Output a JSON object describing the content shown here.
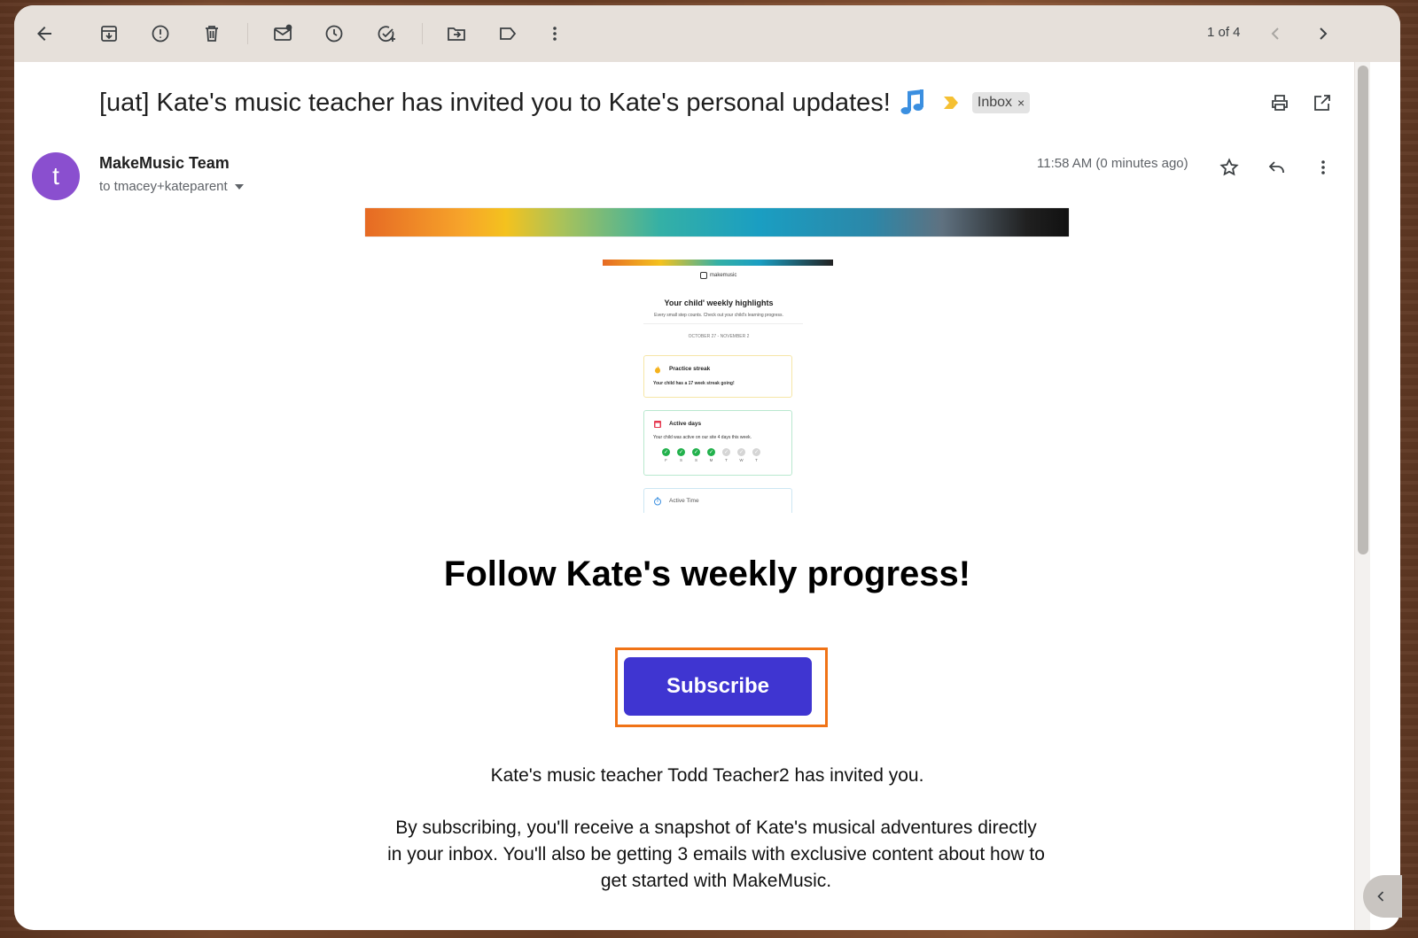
{
  "toolbar": {
    "pager_text": "1 of 4",
    "icons": [
      "back-arrow-icon",
      "archive-icon",
      "report-spam-icon",
      "delete-icon",
      "mark-unread-icon",
      "snooze-icon",
      "add-to-tasks-icon",
      "move-to-icon",
      "label-icon",
      "more-vert-icon",
      "older-chevron-icon",
      "newer-chevron-icon"
    ]
  },
  "email": {
    "subject": "[uat] Kate's music teacher has invited you to Kate's personal updates!",
    "label_chip": "Inbox",
    "label_chip_close": "×",
    "sender_initial": "t",
    "sender_name": "MakeMusic Team",
    "recipient": "to tmacey+kateparent",
    "timestamp": "11:58 AM (0 minutes ago)",
    "avatar_color": "#8a4fcf"
  },
  "preview": {
    "logo_text": "makemusic",
    "title": "Your child' weekly highlights",
    "subtitle": "Every small step counts. Check out your child's learning progress.",
    "date_range": "OCTOBER 27 - NOVEMBER 2",
    "card_streak_title": "Practice streak",
    "card_streak_text": "Your child has a 17 week streak going!",
    "card_days_title": "Active days",
    "card_days_text": "Your child was active on our site 4 days this week.",
    "days": [
      {
        "label": "F",
        "active": true
      },
      {
        "label": "S",
        "active": true
      },
      {
        "label": "S",
        "active": true
      },
      {
        "label": "M",
        "active": true
      },
      {
        "label": "T",
        "active": false
      },
      {
        "label": "W",
        "active": false
      },
      {
        "label": "T",
        "active": false
      }
    ],
    "card_time_title": "Active Time"
  },
  "content": {
    "headline": "Follow Kate's weekly progress!",
    "subscribe_label": "Subscribe",
    "invite_text": "Kate's music teacher Todd Teacher2 has invited you.",
    "body_text": "By subscribing, you'll receive a snapshot of Kate's musical adventures directly in your inbox. You'll also be getting 3 emails with exclusive content about how to get started with MakeMusic."
  },
  "colors": {
    "subscribe_button": "#3f35d1",
    "highlight_outline": "#f07316",
    "toolbar_bg": "#e6e0da"
  }
}
